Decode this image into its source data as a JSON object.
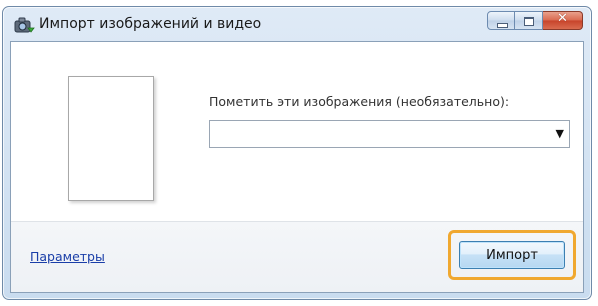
{
  "window": {
    "title": "Импорт изображений и видео",
    "title_icon": "camera-import-icon",
    "caption_buttons": {
      "minimize_icon": "minimize-icon",
      "maximize_icon": "maximize-icon",
      "close_icon": "close-icon",
      "close_glyph": "✕"
    }
  },
  "main": {
    "preview_icon": "image-preview-thumbnail",
    "tag_label": "Пометить эти изображения (необязательно):",
    "tag_input": {
      "value": "",
      "dropdown_icon": "chevron-down-icon",
      "dropdown_glyph": "▼"
    }
  },
  "footer": {
    "settings_link": "Параметры",
    "import_button": "Импорт",
    "highlight_color": "#f0a830"
  }
}
